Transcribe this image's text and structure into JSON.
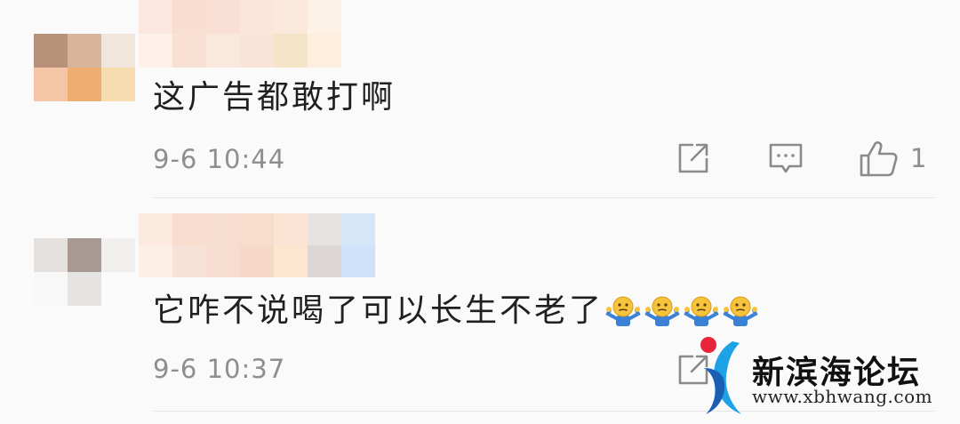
{
  "comments": [
    {
      "text": "这广告都敢打啊",
      "timestamp": "9-6 10:44",
      "like_count": "1",
      "avatar_colors": [
        "#b8917a",
        "#d8b49c",
        "#f0e6dc",
        "#f5c6a6",
        "#eeae72",
        "#f7dcb0"
      ],
      "name_colors": [
        "#fbe7de",
        "#f9ddd0",
        "#fae0d4",
        "#fce6dc",
        "#fbeadc",
        "#fdf2e6",
        "#fdf0e8",
        "#f8e0d2",
        "#fbe8dc",
        "#fae4d8",
        "#f6e4c8",
        "#fdeedd"
      ]
    },
    {
      "text": "它咋不说喝了可以长生不老了",
      "timestamp": "9-6 10:37",
      "emojis": [
        "shrug-emoji",
        "shrug-emoji",
        "shrug-emoji",
        "shrug-emoji"
      ],
      "avatar_colors": [
        "#e4e0de",
        "#a89a92",
        "#f0efee",
        "#f8f8f8",
        "#e6e4e2",
        "#fafafa"
      ],
      "name_colors": [
        "#fbeadd",
        "#f8dccd",
        "#f7dcd0",
        "#f8dccc",
        "#fbe4d4",
        "#e6e2e0",
        "#d4e6f8",
        "#fcefe6",
        "#f6e2d6",
        "#f7ddd0",
        "#f6d8c8",
        "#fce6d0",
        "#dcd6d4",
        "#cfe2fa"
      ]
    }
  ],
  "icons": {
    "share": "share-icon",
    "reply": "reply-icon",
    "like": "thumbs-up-icon"
  },
  "watermark": {
    "name": "新滨海论坛",
    "url": "www.xbhwang.com",
    "colors": {
      "red": "#e8253a",
      "blue": "#1ea2e6",
      "dark_blue": "#1b5fb4"
    }
  }
}
